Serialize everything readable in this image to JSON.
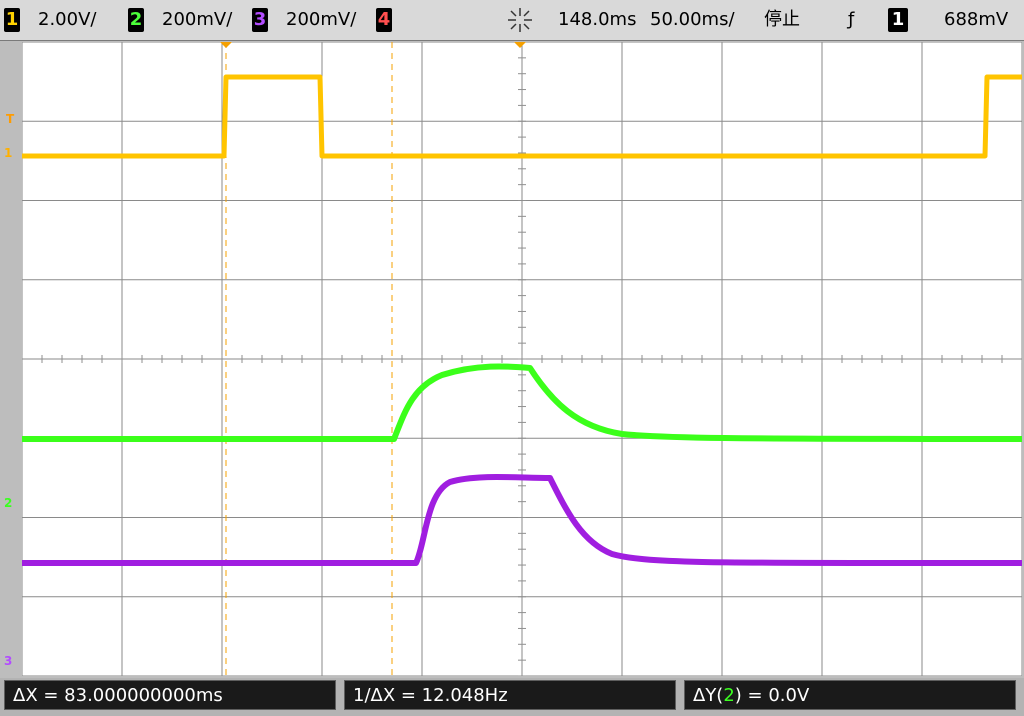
{
  "toolbar": {
    "ch1_badge": "1",
    "ch1_scale": "2.00V/",
    "ch2_badge": "2",
    "ch2_scale": "200mV/",
    "ch3_badge": "3",
    "ch3_scale": "200mV/",
    "ch4_badge": "4",
    "acq_icon": "acquisition-sparkle-icon",
    "delay": "148.0ms",
    "timebase": "50.00ms/",
    "run_status": "停止",
    "trigger_slope_icon": "rising-edge-icon",
    "trigger_slope_glyph": "ƒ",
    "trigger_source": "1",
    "trigger_level": "688mV"
  },
  "markers": {
    "trigger": "T",
    "ch1": "1",
    "ch2": "2",
    "ch3": "3"
  },
  "measurements": {
    "delta_x": "ΔX = 83.000000000ms",
    "inverse_delta_x": "1/ΔX = 12.048Hz",
    "delta_y_prefix": "ΔY(",
    "delta_y_channel": "2",
    "delta_y_suffix": ") = 0.0V"
  },
  "colors": {
    "ch1": "#ffc400",
    "ch2": "#3bff1a",
    "ch3": "#a01ee0",
    "grid": "#8a8a8a",
    "cursor": "#f5a000"
  }
}
